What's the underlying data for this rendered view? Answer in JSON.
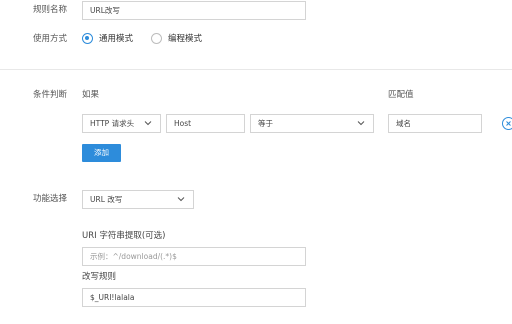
{
  "rule_name": {
    "label": "规则名称",
    "value": "URL改写"
  },
  "usage_mode": {
    "label": "使用方式",
    "options": [
      {
        "label": "通用模式",
        "selected": true
      },
      {
        "label": "编程模式",
        "selected": false
      }
    ]
  },
  "condition": {
    "label": "条件判断",
    "if_header": "如果",
    "match_header": "匹配值",
    "row": {
      "type_value": "HTTP 请求头",
      "field_value": "Host",
      "operator_value": "等于",
      "match_value": "域名"
    },
    "add_label": "添加"
  },
  "function": {
    "label": "功能选择",
    "selected": "URL 改写",
    "uri_extract_label": "URI 字符串提取(可选)",
    "uri_extract_placeholder": "示例：^/download/(.*)$",
    "rewrite_label": "改写规则",
    "rewrite_value": "$_URI!lalala"
  },
  "colors": {
    "accent": "#2d8cdb",
    "border": "#d4d4d4",
    "label": "#555555"
  },
  "icons": {
    "dropdown": "chevron-down-icon",
    "remove": "close-circle-icon"
  }
}
